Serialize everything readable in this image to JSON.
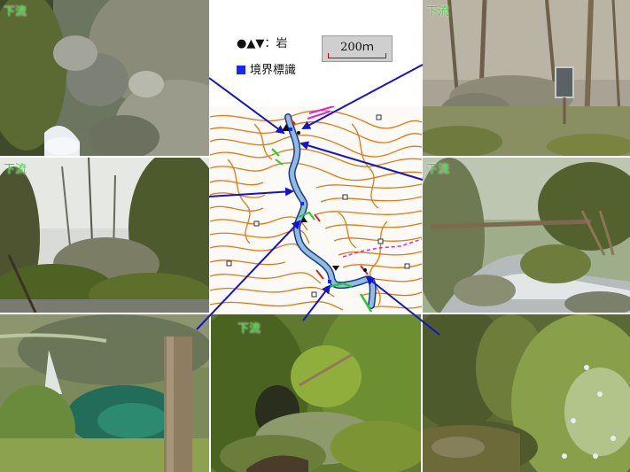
{
  "captions": {
    "downstream": "下流"
  },
  "legend": {
    "rock_label": "●▲▼：岩",
    "boundary_label": "境界標識",
    "scale": "200ｍ"
  },
  "colors": {
    "contour": "#e07a10",
    "river": "#8fbce0",
    "route": "#1a3a8a",
    "arrow": "#1414c8",
    "boundary_marker": "#1428ff",
    "caption": "#3ad23a",
    "scale_bar": "#d00000",
    "green_trail": "#22cc22",
    "magenta_line": "#e020e0",
    "red_line": "#e02020"
  },
  "icons": [
    "rock-symbols",
    "boundary-marker-square"
  ]
}
